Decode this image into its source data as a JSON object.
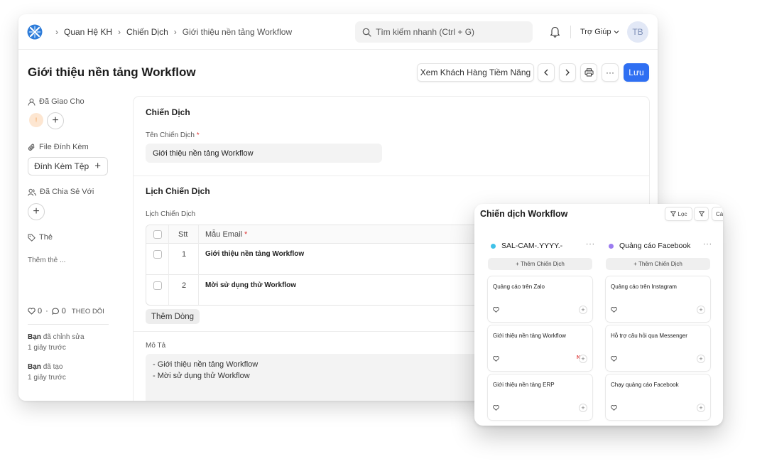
{
  "navbar": {
    "breadcrumbs": [
      "Quan Hệ KH",
      "Chiến Dịch",
      "Giới thiệu nền tảng Workflow"
    ],
    "search_placeholder": "Tìm kiếm nhanh (Ctrl + G)",
    "help_label": "Trợ Giúp",
    "avatar_initials": "TB"
  },
  "title_bar": {
    "title": "Giới thiệu nền tảng Workflow",
    "view_leads_label": "Xem Khách Hàng Tiềm Năng",
    "more_label": "···",
    "save_label": "Lưu"
  },
  "sidebar": {
    "assigned_label": "Đã Giao Cho",
    "assigned_avatar": "!",
    "attachments_label": "File Đính Kèm",
    "attach_button_label": "Đính Kèm Tệp",
    "shared_label": "Đã Chia Sẻ Với",
    "tags_label": "Thẻ",
    "tags_placeholder": "Thêm thẻ ...",
    "likes_count": "0",
    "comments_count": "0",
    "separator": "·",
    "follow_label": "THEO DÕI",
    "activity": [
      {
        "user": "Bạn",
        "action": "đã chỉnh sửa",
        "time": "1 giây trước"
      },
      {
        "user": "Bạn",
        "action": "đã tạo",
        "time": "1 giây trước"
      }
    ]
  },
  "form": {
    "section1_title": "Chiến Dịch",
    "campaign_name_label": "Tên Chiến Dịch",
    "required_mark": "*",
    "campaign_name_value": "Giới thiệu nền tảng Workflow",
    "section2_title": "Lịch Chiến Dịch",
    "schedule_label": "Lịch Chiến Dịch",
    "table": {
      "col_no": "Stt",
      "col_template": "Mẫu Email",
      "rows": [
        {
          "no": "1",
          "template": "Giới thiệu nền tảng Workflow"
        },
        {
          "no": "2",
          "template": "Mời sử dụng thử Workflow"
        }
      ]
    },
    "add_row_label": "Thêm Dòng",
    "description_label": "Mô Tả",
    "description_lines": [
      "- Giới thiệu nền tảng Workflow",
      "- Mời sử dụng thử Workflow"
    ]
  },
  "kanban": {
    "title": "Chiến dịch Workflow",
    "filter_label": "Lọc",
    "cut_label": "Cà",
    "add_label": "+ Thêm Chiến Dịch",
    "new_badge": "N",
    "columns": [
      {
        "title": "SAL-CAM-.YYYY.-",
        "dot_color": "#3fc1e8",
        "cards": [
          "Quảng cáo trên Zalo",
          "Giới thiệu nền tảng Workflow",
          "Giới thiệu nền tảng ERP"
        ]
      },
      {
        "title": "Quảng cáo Facebook",
        "dot_color": "#9b7bf0",
        "cards": [
          "Quảng cáo trên Instagram",
          "Hỗ trợ câu hỏi qua Messenger",
          "Chạy quảng cáo Facebook"
        ]
      }
    ]
  },
  "colors": {
    "primary": "#2f6ff2",
    "required": "#e03636"
  }
}
